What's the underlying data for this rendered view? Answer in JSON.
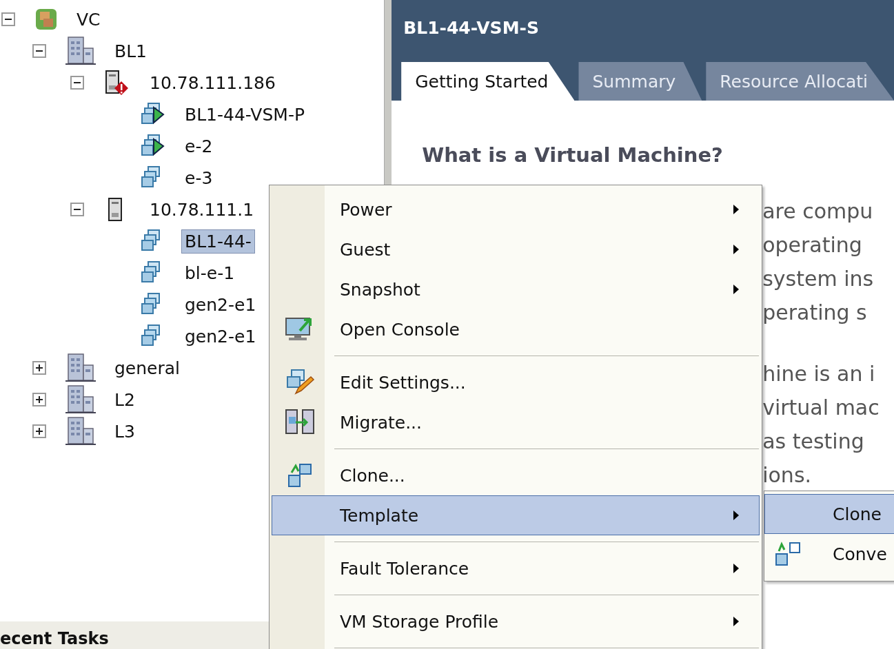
{
  "tree": [
    {
      "label": "VC",
      "kind": "vcenter",
      "expanded": true,
      "selected": false,
      "children": [
        {
          "label": "BL1",
          "kind": "datacenter",
          "expanded": true,
          "selected": false,
          "children": [
            {
              "label": "10.78.111.186",
              "kind": "host",
              "alert": true,
              "expanded": true,
              "selected": false,
              "children": [
                {
                  "label": "BL1-44-VSM-P",
                  "kind": "vm",
                  "powered_on": true,
                  "selected": false
                },
                {
                  "label": "e-2",
                  "kind": "vm",
                  "powered_on": true,
                  "selected": false
                },
                {
                  "label": "e-3",
                  "kind": "vm",
                  "powered_on": false,
                  "selected": false
                }
              ]
            },
            {
              "label": "10.78.111.1",
              "kind": "host",
              "alert": false,
              "expanded": true,
              "selected": false,
              "children": [
                {
                  "label": "BL1-44-",
                  "kind": "vm",
                  "powered_on": false,
                  "selected": true
                },
                {
                  "label": "bl-e-1",
                  "kind": "vm",
                  "powered_on": false,
                  "selected": false
                },
                {
                  "label": "gen2-e1",
                  "kind": "vm",
                  "powered_on": false,
                  "selected": false
                },
                {
                  "label": "gen2-e1",
                  "kind": "vm",
                  "powered_on": false,
                  "selected": false
                }
              ]
            }
          ]
        },
        {
          "label": "general",
          "kind": "datacenter",
          "expanded": false,
          "selected": false
        },
        {
          "label": "L2",
          "kind": "datacenter",
          "expanded": false,
          "selected": false
        },
        {
          "label": "L3",
          "kind": "datacenter",
          "expanded": false,
          "selected": false
        }
      ]
    }
  ],
  "recent_tasks": {
    "title": "ecent Tasks"
  },
  "panel": {
    "title": "BL1-44-VSM-S",
    "tabs": [
      {
        "label": "Getting Started",
        "selected": true
      },
      {
        "label": "Summary",
        "selected": false
      },
      {
        "label": "Resource Allocati",
        "selected": false
      }
    ],
    "heading": "What is a Virtual Machine?",
    "paragraphs": [
      [
        "are compu",
        "operating",
        "system ins",
        "perating s"
      ],
      [
        "hine is an i",
        "virtual mac",
        "as testing",
        "ions."
      ]
    ]
  },
  "context_menu": [
    {
      "kind": "item",
      "label": "Power",
      "submenu": true,
      "selected": false
    },
    {
      "kind": "item",
      "label": "Guest",
      "submenu": true,
      "selected": false
    },
    {
      "kind": "item",
      "label": "Snapshot",
      "submenu": true,
      "selected": false
    },
    {
      "kind": "item",
      "label": "Open Console",
      "submenu": false,
      "selected": false
    },
    {
      "kind": "separator"
    },
    {
      "kind": "item",
      "label": "Edit Settings...",
      "submenu": false,
      "selected": false
    },
    {
      "kind": "item",
      "label": "Migrate...",
      "submenu": false,
      "selected": false
    },
    {
      "kind": "separator"
    },
    {
      "kind": "item",
      "label": "Clone...",
      "submenu": false,
      "selected": false
    },
    {
      "kind": "item",
      "label": "Template",
      "submenu": true,
      "selected": true
    },
    {
      "kind": "separator"
    },
    {
      "kind": "item",
      "label": "Fault Tolerance",
      "submenu": true,
      "selected": false
    },
    {
      "kind": "separator"
    },
    {
      "kind": "item",
      "label": "VM Storage Profile",
      "submenu": true,
      "selected": false
    },
    {
      "kind": "separator"
    }
  ],
  "submenu": [
    {
      "label": "Clone",
      "selected": true
    },
    {
      "label": "Conve",
      "selected": false
    }
  ]
}
